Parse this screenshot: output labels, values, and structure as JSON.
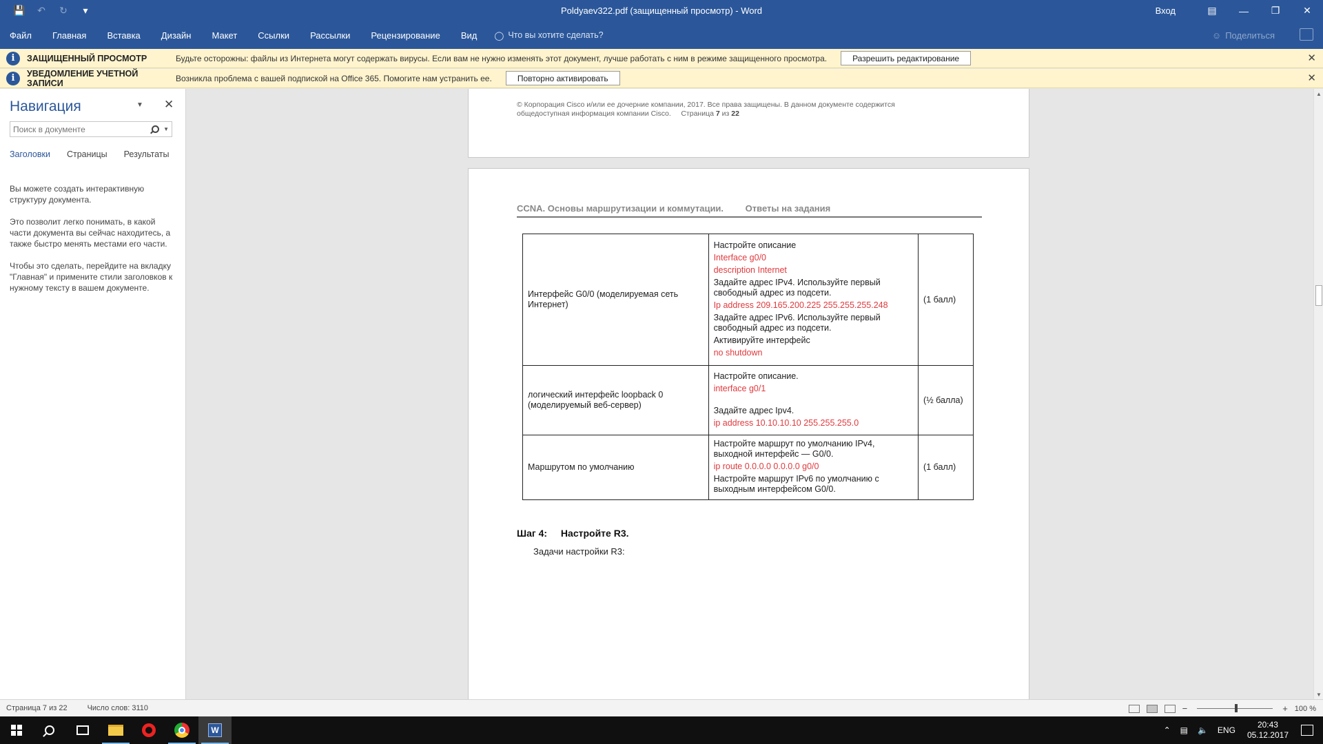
{
  "window": {
    "title": "Poldyaev322.pdf (защищенный просмотр) - Word",
    "signin": "Вход"
  },
  "ribbon": {
    "tabs": [
      "Файл",
      "Главная",
      "Вставка",
      "Дизайн",
      "Макет",
      "Ссылки",
      "Рассылки",
      "Рецензирование",
      "Вид"
    ],
    "tellme": "Что вы хотите сделать?",
    "share": "Поделиться"
  },
  "protected_bar": {
    "title": "ЗАЩИЩЕННЫЙ ПРОСМОТР",
    "text": "Будьте осторожны: файлы из Интернета могут содержать вирусы. Если вам не нужно изменять этот документ, лучше работать с ним в режиме защищенного просмотра.",
    "button": "Разрешить редактирование"
  },
  "account_bar": {
    "title": "УВЕДОМЛЕНИЕ УЧЕТНОЙ ЗАПИСИ",
    "text": "Возникла проблема с вашей подпиской на Office 365. Помогите нам устранить ее.",
    "button": "Повторно активировать"
  },
  "navigation": {
    "title": "Навигация",
    "search_placeholder": "Поиск в документе",
    "tabs": [
      "Заголовки",
      "Страницы",
      "Результаты"
    ],
    "body": [
      "Вы можете создать интерактивную структуру документа.",
      "Это позволит легко понимать, в какой части документа вы сейчас находитесь, а также быстро менять местами его части.",
      "Чтобы это сделать, перейдите на вкладку \"Главная\" и примените стили заголовков к нужному тексту в вашем документе."
    ]
  },
  "document": {
    "footer_line1": "© Корпорация Cisco и/или ее дочерние компании, 2017. Все права защищены. В данном документе содержится",
    "footer_line2": "общедоступная информация компании Cisco.",
    "footer_page_word": "Страница",
    "footer_page_num": "7",
    "footer_of": "из",
    "footer_total": "22",
    "header_left": "CCNA. Основы маршрутизации и коммутации.",
    "header_right": "Ответы на задания",
    "rows": [
      {
        "name": "Интерфейс G0/0 (моделируемая сеть Интернет)",
        "lines": [
          {
            "t": "Настройте описание",
            "red": false
          },
          {
            "t": "Interface g0/0",
            "red": true
          },
          {
            "t": "description Internet",
            "red": true
          },
          {
            "t": "Задайте адрес IPv4. Используйте первый свободный адрес из подсети.",
            "red": false
          },
          {
            "t": "Ip address 209.165.200.225 255.255.255.248",
            "red": true
          },
          {
            "t": "Задайте адрес IPv6. Используйте первый свободный адрес из подсети.",
            "red": false
          },
          {
            "t": "Активируйте интерфейс",
            "red": false
          },
          {
            "t": "no shutdown",
            "red": true
          }
        ],
        "points": "(1 балл)"
      },
      {
        "name": "логический интерфейс loopback 0 (моделируемый веб-сервер)",
        "lines": [
          {
            "t": "Настройте описание.",
            "red": false
          },
          {
            "t": "interface g0/1",
            "red": true
          },
          {
            "t": "",
            "red": false
          },
          {
            "t": "Задайте адрес Ipv4.",
            "red": false
          },
          {
            "t": "ip address 10.10.10.10 255.255.255.0",
            "red": true
          }
        ],
        "points": "(½ балла)"
      },
      {
        "name": "Маршрутом по умолчанию",
        "lines": [
          {
            "t": "Настройте маршрут по умолчанию IPv4, выходной интерфейс — G0/0.",
            "red": false
          },
          {
            "t": "ip route 0.0.0.0 0.0.0.0 g0/0",
            "red": true
          },
          {
            "t": "Настройте маршрут IPv6 по умолчанию с выходным интерфейсом G0/0.",
            "red": false
          }
        ],
        "points": "(1 балл)"
      }
    ],
    "step_label": "Шаг 4:",
    "step_title": "Настройте R3.",
    "task": "Задачи настройки R3:"
  },
  "statusbar": {
    "page": "Страница 7 из 22",
    "words": "Число слов: 3110",
    "zoom": "100 %"
  },
  "taskbar": {
    "lang": "ENG",
    "time": "20:43",
    "date": "05.12.2017"
  },
  "colors": {
    "word_blue": "#2b579a",
    "message_bar": "#fff4ce",
    "answer_red": "#e03a3e"
  }
}
